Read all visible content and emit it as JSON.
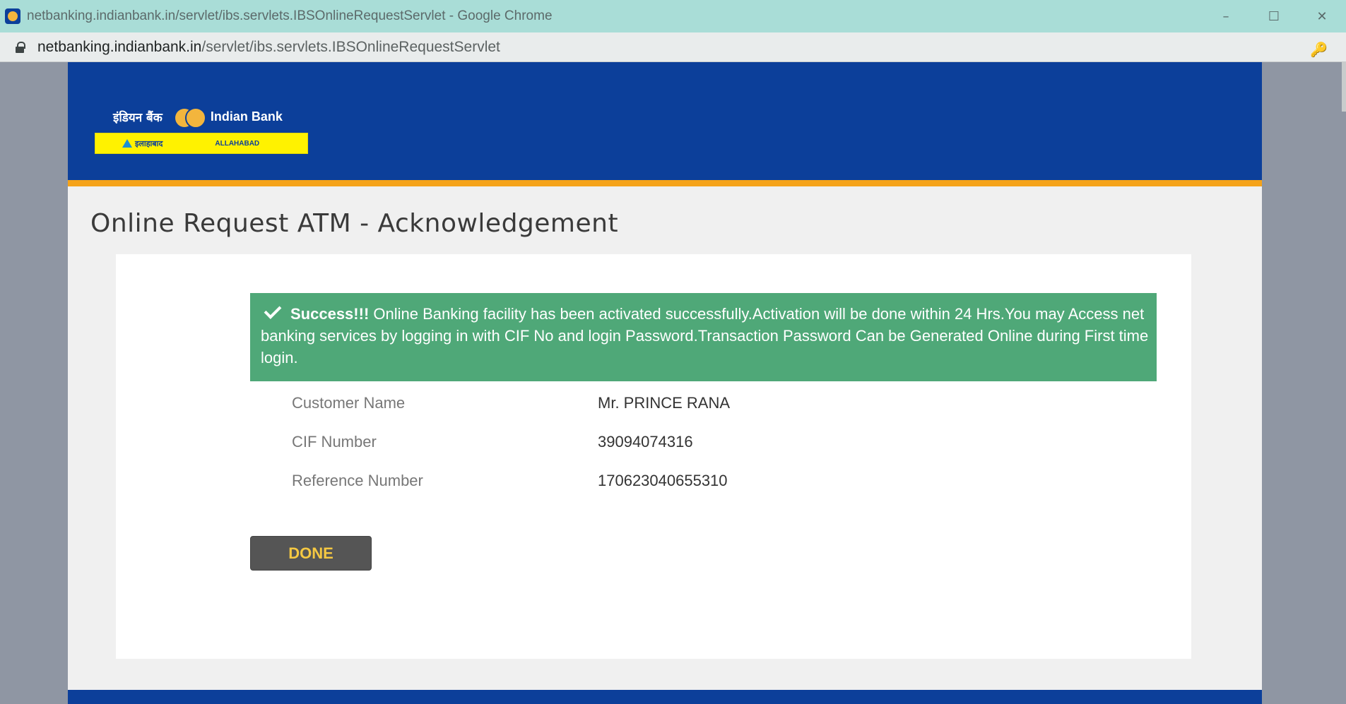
{
  "window": {
    "title": "netbanking.indianbank.in/servlet/ibs.servlets.IBSOnlineRequestServlet - Google Chrome",
    "controls": {
      "minimize": "–",
      "maximize": "☐",
      "close": "✕"
    }
  },
  "address_bar": {
    "host": "netbanking.indianbank.in",
    "path": "/servlet/ibs.servlets.IBSOnlineRequestServlet",
    "key_icon": "🔑"
  },
  "logo": {
    "hindi_name": "इंडियन बैंक",
    "english_name": "Indian Bank",
    "band_hindi": "इलाहाबाद",
    "band_english": "ALLAHABAD"
  },
  "page": {
    "title": "Online Request ATM - Acknowledgement"
  },
  "alert": {
    "strong": "Success!!!",
    "message": " Online Banking facility has been activated successfully.Activation will be done within 24 Hrs.You may Access net banking services by logging in with CIF No and login Password.Transaction Password Can be Generated Online during First time login."
  },
  "details": [
    {
      "label": "Customer Name",
      "value": "Mr. PRINCE RANA"
    },
    {
      "label": "CIF Number",
      "value": "39094074316"
    },
    {
      "label": "Reference Number",
      "value": "170623040655310"
    }
  ],
  "done_button": {
    "label": "DONE"
  },
  "colors": {
    "header_blue": "#0c3f9a",
    "accent_orange": "#f5a31a",
    "success_green": "#4fa878",
    "button_text": "#f5c842"
  }
}
